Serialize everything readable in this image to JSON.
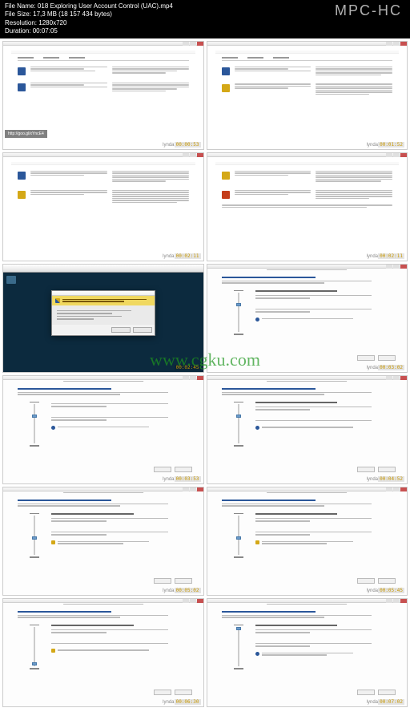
{
  "header": {
    "filename_label": "File Name:",
    "filename": "018 Exploring User Account Control (UAC).mp4",
    "filesize_label": "File Size:",
    "filesize": "17,3 MB (18 157 434 bytes)",
    "resolution_label": "Resolution:",
    "resolution": "1280x720",
    "duration_label": "Duration:",
    "duration": "00:07:05",
    "app_logo": "MPC-HC"
  },
  "lynda": "lynda",
  "url_badge": "http://goo.gl/xYncE4",
  "watermark": "www.cgku.com",
  "timestamps": [
    "00:00:53",
    "00:01:52",
    "00:02:11",
    "00:02:11",
    "00:02:45",
    "00:03:02",
    "00:03:53",
    "00:04:52",
    "00:05:02",
    "00:05:45",
    "00:06:30",
    "00:07:02"
  ],
  "uac_prompt": "Do you want to allow the following program to make changes to this computer?",
  "slider": {
    "always": "Always notify",
    "never": "Never notify"
  }
}
